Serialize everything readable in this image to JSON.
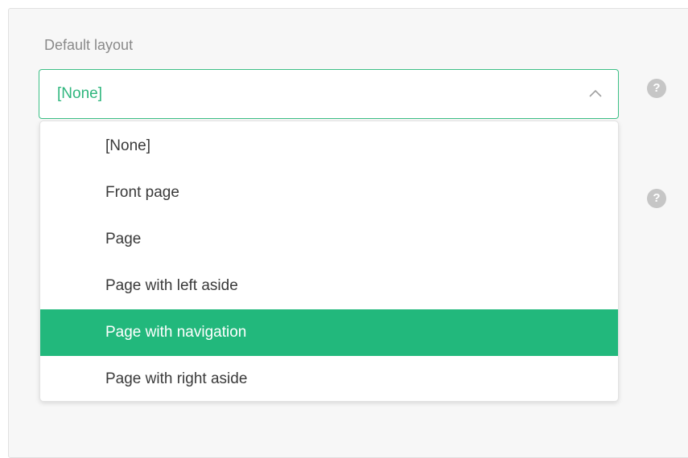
{
  "form": {
    "default_layout_label": "Default layout",
    "select_value": "[None]",
    "help_glyph": "?"
  },
  "dropdown": {
    "options": [
      {
        "label": "[None]",
        "selected": false
      },
      {
        "label": "Front page",
        "selected": false
      },
      {
        "label": "Page",
        "selected": false
      },
      {
        "label": "Page with left aside",
        "selected": false
      },
      {
        "label": "Page with navigation",
        "selected": true
      },
      {
        "label": "Page with right aside",
        "selected": false
      }
    ]
  },
  "colors": {
    "accent": "#2eb67d",
    "selected_bg": "#22b87c",
    "help_icon": "#c6c6c6"
  },
  "icons": {
    "select_toggle": "chevron-up-icon",
    "help": "help-icon"
  }
}
